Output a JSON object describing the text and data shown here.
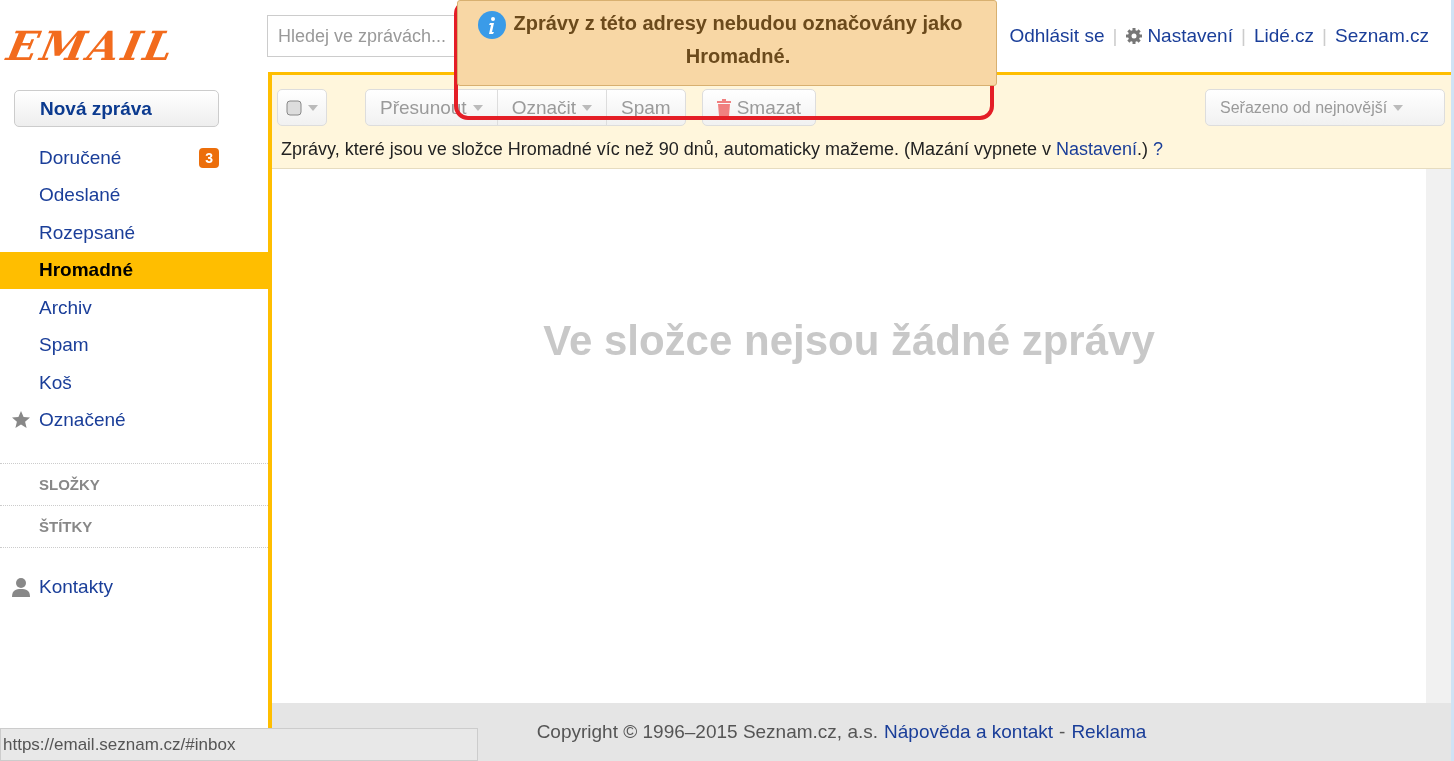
{
  "logo": {
    "text": "EMAIL"
  },
  "search": {
    "placeholder": "Hledej ve zprávách..."
  },
  "top_separator": "|",
  "top_links": [
    {
      "label": "Odhlásit se",
      "kind": "link"
    },
    {
      "label": "Nastavení",
      "kind": "settings"
    },
    {
      "label": "Lidé.cz",
      "kind": "link"
    },
    {
      "label": "Seznam.cz",
      "kind": "link"
    }
  ],
  "toast": {
    "text": "Zprávy z této adresy nebudou označovány jako Hromadné."
  },
  "compose": "Nová zpráva",
  "folders": [
    {
      "label": "Doručené",
      "badge": "3",
      "selected": false
    },
    {
      "label": "Odeslané",
      "selected": false
    },
    {
      "label": "Rozepsané",
      "selected": false
    },
    {
      "label": "Hromadné",
      "selected": true
    },
    {
      "label": "Archiv",
      "selected": false
    },
    {
      "label": "Spam",
      "selected": false
    },
    {
      "label": "Koš",
      "selected": false
    },
    {
      "label": "Označené",
      "kind": "starred",
      "selected": false
    }
  ],
  "sections": [
    "SLOŽKY",
    "ŠTÍTKY"
  ],
  "contacts": "Kontakty",
  "toolbar": {
    "select_all": {
      "checked": false
    },
    "buttons": [
      {
        "label": "Přesunout",
        "dropdown": true,
        "disabled": true
      },
      {
        "label": "Označit",
        "dropdown": true,
        "disabled": true
      },
      {
        "label": "Spam",
        "dropdown": false,
        "disabled": true
      }
    ],
    "delete": {
      "label": "Smazat",
      "disabled": true
    },
    "sort": {
      "label": "Seřazeno od nejnovější",
      "disabled": true
    }
  },
  "notice": {
    "text": "Zprávy, které jsou ve složce Hromadné víc než 90 dnů, automaticky mažeme. (Mazání vypnete v ",
    "link": "Nastavení",
    "tail": ".)",
    "help": "?"
  },
  "empty_message": "Ve složce nejsou žádné zprávy",
  "footer": {
    "copyright": "Copyright © 1996–2015 Seznam.cz, a.s.",
    "links": [
      "Nápověda a kontakt",
      "Reklama"
    ],
    "separator": "-"
  },
  "status_bar": "https://email.seznam.cz/#inbox"
}
